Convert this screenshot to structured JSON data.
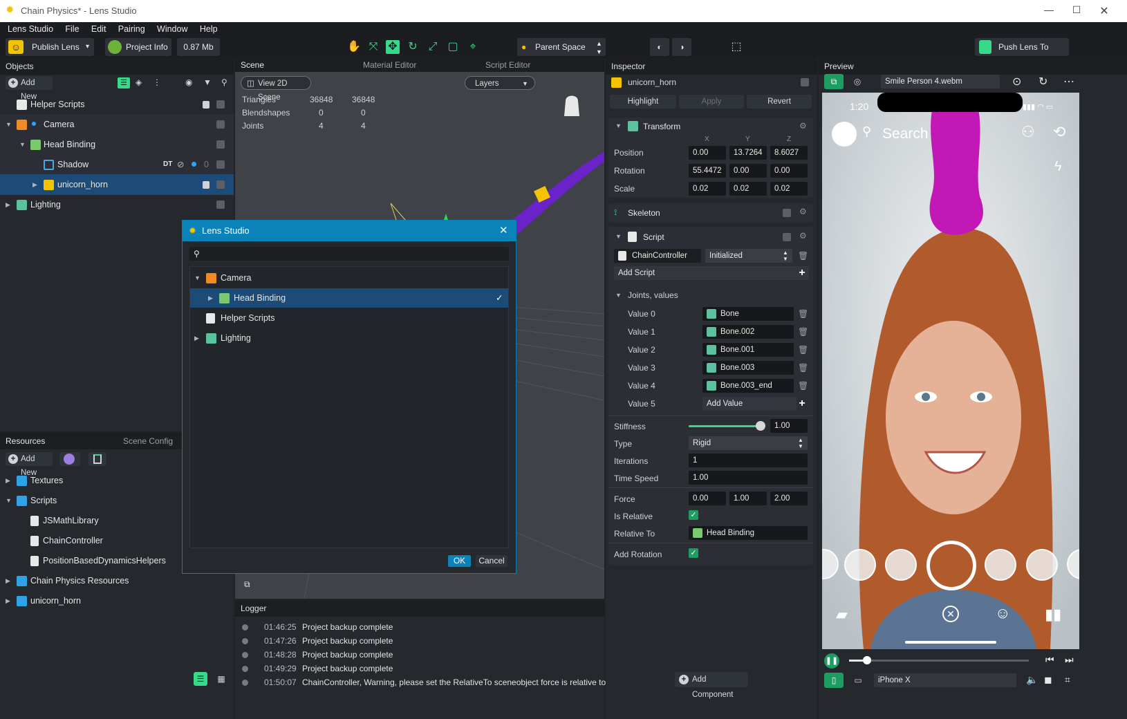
{
  "window": {
    "title": "Chain Physics* - Lens Studio"
  },
  "menu": [
    "Lens Studio",
    "File",
    "Edit",
    "Pairing",
    "Window",
    "Help"
  ],
  "toolbar": {
    "publish_label": "Publish Lens",
    "project_info_label": "Project Info",
    "size": "0.87 Mb",
    "space_label": "Parent Space",
    "push_label": "Push Lens To Device"
  },
  "objects": {
    "title": "Objects",
    "add_new": "Add New",
    "items": [
      {
        "label": "Helper Scripts"
      },
      {
        "label": "Camera"
      },
      {
        "label": "Head Binding"
      },
      {
        "label": "Shadow",
        "extra": "DT",
        "count": "0"
      },
      {
        "label": "unicorn_horn"
      },
      {
        "label": "Lighting"
      }
    ]
  },
  "resources": {
    "tab_resources": "Resources",
    "tab_scene_config": "Scene Config",
    "add_new": "Add New",
    "items": [
      {
        "label": "Textures"
      },
      {
        "label": "Scripts"
      },
      {
        "label": "JSMathLibrary"
      },
      {
        "label": "ChainController"
      },
      {
        "label": "PositionBasedDynamicsHelpers"
      },
      {
        "label": "Chain Physics Resources"
      },
      {
        "label": "unicorn_horn"
      }
    ]
  },
  "scene": {
    "tabs": [
      "Scene",
      "Material Editor",
      "Script Editor"
    ],
    "view2d": "View 2D Scene",
    "layers": "Layers",
    "stats": [
      {
        "k": "Triangles",
        "a": "36848",
        "b": "36848"
      },
      {
        "k": "Blendshapes",
        "a": "0",
        "b": "0"
      },
      {
        "k": "Joints",
        "a": "4",
        "b": "4"
      }
    ]
  },
  "dialog": {
    "title": "Lens Studio",
    "search_placeholder": "",
    "items": [
      {
        "label": "Camera"
      },
      {
        "label": "Head Binding"
      },
      {
        "label": "Helper Scripts"
      },
      {
        "label": "Lighting"
      }
    ],
    "ok": "OK",
    "cancel": "Cancel"
  },
  "logger": {
    "title": "Logger",
    "rows": [
      {
        "t": "01:46:25",
        "m": "Project backup complete"
      },
      {
        "t": "01:47:26",
        "m": "Project backup complete"
      },
      {
        "t": "01:48:28",
        "m": "Project backup complete"
      },
      {
        "t": "01:49:29",
        "m": "Project backup complete"
      },
      {
        "t": "01:50:07",
        "m": "ChainController, Warning, please set the RelativeTo sceneobject force is relative to"
      }
    ]
  },
  "inspector": {
    "title": "Inspector",
    "object": "unicorn_horn",
    "highlight": "Highlight",
    "apply": "Apply",
    "revert": "Revert",
    "transform": {
      "title": "Transform",
      "x": "X",
      "y": "Y",
      "z": "Z",
      "position": {
        "label": "Position",
        "v": [
          "0.00",
          "13.7264",
          "8.6027"
        ]
      },
      "rotation": {
        "label": "Rotation",
        "v": [
          "55.4472",
          "0.00",
          "0.00"
        ]
      },
      "scale": {
        "label": "Scale",
        "v": [
          "0.02",
          "0.02",
          "0.02"
        ]
      }
    },
    "skeleton": "Skeleton",
    "script": {
      "title": "Script",
      "name": "ChainController",
      "state": "Initialized",
      "add_script": "Add Script"
    },
    "joints": {
      "title": "Joints, values",
      "rows": [
        {
          "label": "Value 0",
          "value": "Bone"
        },
        {
          "label": "Value 1",
          "value": "Bone.002"
        },
        {
          "label": "Value 2",
          "value": "Bone.001"
        },
        {
          "label": "Value 3",
          "value": "Bone.003"
        },
        {
          "label": "Value 4",
          "value": "Bone.003_end"
        },
        {
          "label": "Value 5",
          "value": "Add Value"
        }
      ]
    },
    "stiffness": {
      "label": "Stiffness",
      "value": "1.00",
      "level": 1.0
    },
    "type": {
      "label": "Type",
      "value": "Rigid"
    },
    "iterations": {
      "label": "Iterations",
      "value": "1"
    },
    "time_speed": {
      "label": "Time Speed",
      "value": "1.00"
    },
    "force": {
      "label": "Force",
      "v": [
        "0.00",
        "1.00",
        "2.00"
      ]
    },
    "is_relative": {
      "label": "Is Relative"
    },
    "relative_to": {
      "label": "Relative To",
      "value": "Head Binding"
    },
    "add_rotation": {
      "label": "Add Rotation"
    },
    "add_component": "Add Component"
  },
  "preview": {
    "title": "Preview",
    "video": "Smile Person 4.webm",
    "time": "1:20",
    "search": "Search",
    "device": "iPhone X",
    "progress": 0.1
  },
  "colors": {
    "accent": "#0b83b9",
    "selection": "#1d4b78",
    "green": "#39d98a",
    "horn": "#c218b6"
  }
}
